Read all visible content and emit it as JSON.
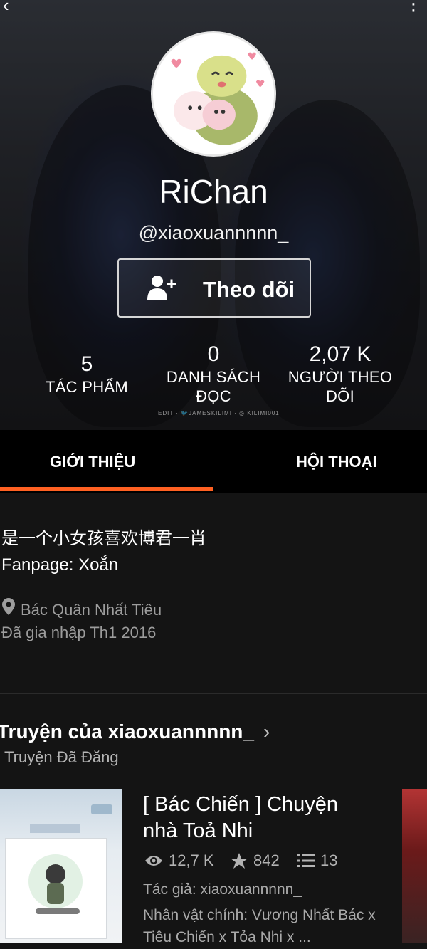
{
  "profile": {
    "display_name": "RiChan",
    "username": "@xiaoxuannnnn_",
    "follow_label": "Theo dõi"
  },
  "stats": {
    "works_value": "5",
    "works_label": "TÁC PHẨM",
    "reading_lists_value": "0",
    "reading_lists_label_1": "DANH SÁCH",
    "reading_lists_label_2": "ĐỌC",
    "followers_value": "2,07 K",
    "followers_label_1": "NGƯỜI THEO",
    "followers_label_2": "DÕI"
  },
  "cover_watermark": "EDIT · 🐦JAMESKILIMI · ◎ KILIMI001",
  "tabs": {
    "about": "GIỚI THIỆU",
    "conversations": "HỘI THOẠI"
  },
  "about": {
    "bio_line_1": "是一个小女孩喜欢博君一肖",
    "bio_line_2": "Fanpage: Xoắn",
    "location": "Bác Quân Nhất Tiêu",
    "joined": "Đã gia nhập Th1 2016"
  },
  "stories": {
    "title": "Truyện của xiaoxuannnnn_",
    "subtitle": "Truyện Đã Đăng",
    "items": [
      {
        "title": "[ Bác Chiến ] Chuyện nhà Toả Nhi",
        "reads": "12,7 K",
        "votes": "842",
        "parts": "13",
        "author": "Tác giả: xiaoxuannnnn_",
        "characters": "Nhân vật chính: Vương Nhất Bác x Tiêu Chiến x Tỏa Nhi x ..."
      }
    ]
  },
  "colors": {
    "accent": "#ff6122",
    "background": "#141414",
    "tab_bar": "#000000",
    "muted_text": "#9d9d9d"
  },
  "icons": [
    "back-icon",
    "menu-icon",
    "add-user-icon",
    "location-pin-icon",
    "chevron-right-icon",
    "eye-icon",
    "star-icon",
    "list-icon"
  ]
}
